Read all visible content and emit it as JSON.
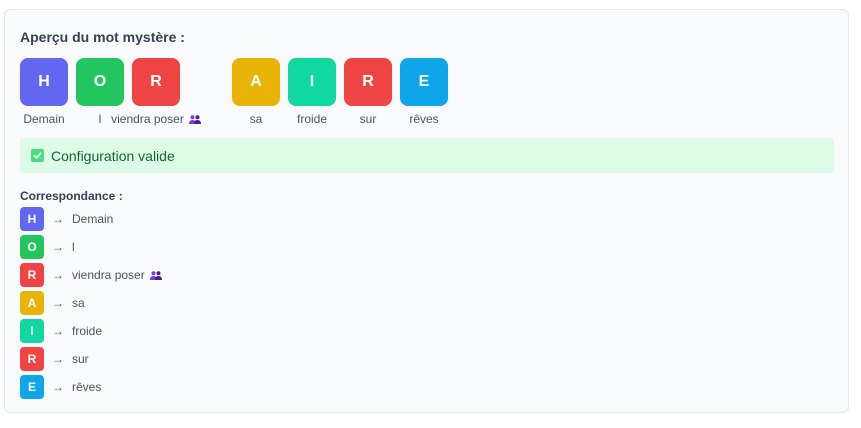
{
  "preview": {
    "title": "Aperçu du mot mystère :",
    "tiles": [
      {
        "letter": "H",
        "word": "Demain",
        "color": "#6366f1",
        "group": false
      },
      {
        "letter": "O",
        "word": "l",
        "color": "#22c55e",
        "group": false
      },
      {
        "letter": "R",
        "word": "viendra poser",
        "color": "#ef4444",
        "group": true
      },
      {
        "letter": "A",
        "word": "sa",
        "color": "#eab308",
        "group": false
      },
      {
        "letter": "I",
        "word": "froide",
        "color": "#10d9a0",
        "group": false
      },
      {
        "letter": "R",
        "word": "sur",
        "color": "#ef4444",
        "group": false
      },
      {
        "letter": "E",
        "word": "rêves",
        "color": "#0ea5e9",
        "group": false
      }
    ]
  },
  "status": {
    "text": "Configuration valide",
    "color": "#166534",
    "background": "#dcfce7"
  },
  "mapping": {
    "title": "Correspondance :",
    "arrow": "→",
    "items": [
      {
        "letter": "H",
        "word": "Demain",
        "color": "#6366f1",
        "group": false
      },
      {
        "letter": "O",
        "word": "l",
        "color": "#22c55e",
        "group": false
      },
      {
        "letter": "R",
        "word": "viendra poser",
        "color": "#ef4444",
        "group": true
      },
      {
        "letter": "A",
        "word": "sa",
        "color": "#eab308",
        "group": false
      },
      {
        "letter": "I",
        "word": "froide",
        "color": "#10d9a0",
        "group": false
      },
      {
        "letter": "R",
        "word": "sur",
        "color": "#ef4444",
        "group": false
      },
      {
        "letter": "E",
        "word": "rêves",
        "color": "#0ea5e9",
        "group": false
      }
    ]
  }
}
